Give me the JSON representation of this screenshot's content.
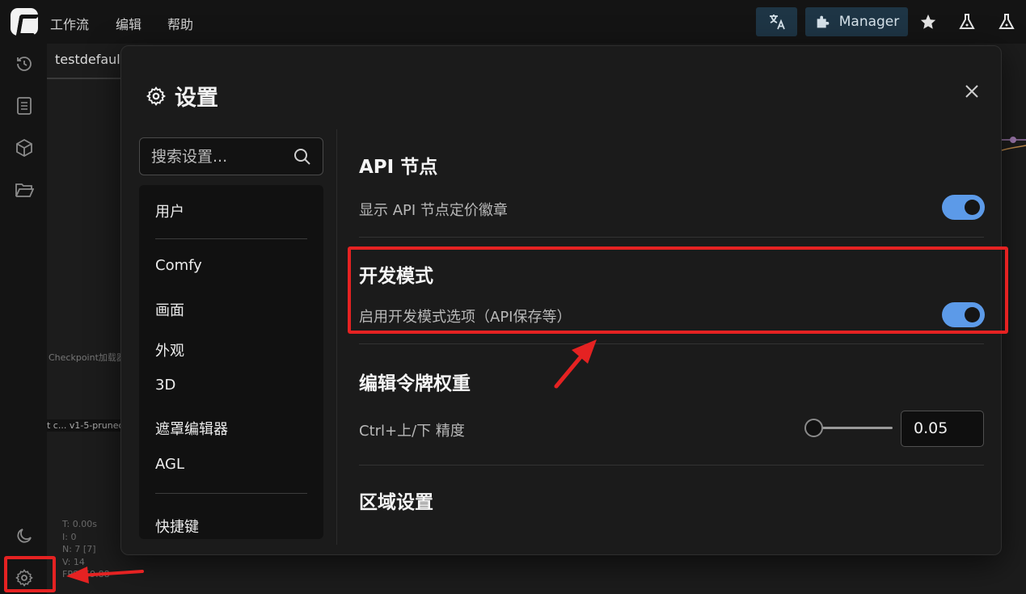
{
  "menu": {
    "workflow": "工作流",
    "edit": "编辑",
    "help": "帮助"
  },
  "toolbar": {
    "manager_label": "Manager"
  },
  "tab": {
    "name": "testdefault"
  },
  "canvas": {
    "node_label": "Checkpoint加载器",
    "model_text": "t c... v1-5-pruned-",
    "stats": [
      "T: 0.00s",
      "I: 0",
      "N: 7 [7]",
      "V: 14",
      "FPS: 59.88"
    ]
  },
  "dialog": {
    "title": "设置",
    "search_placeholder": "搜索设置...",
    "categories": [
      "用户",
      "Comfy",
      "画面",
      "外观",
      "3D",
      "遮罩编辑器",
      "AGL",
      "快捷键"
    ],
    "sections": [
      {
        "title": "API 节点",
        "setting": "显示 API 节点定价徽章",
        "enabled": true
      },
      {
        "title": "开发模式",
        "setting": "启用开发模式选项（API保存等）",
        "enabled": true
      },
      {
        "title": "编辑令牌权重",
        "setting": "Ctrl+上/下 精度",
        "value": "0.05"
      },
      {
        "title": "区域设置"
      }
    ]
  },
  "colors": {
    "accent": "#5c9ae8",
    "annotation": "#e52222",
    "toolbar_button": "#1e3545"
  }
}
